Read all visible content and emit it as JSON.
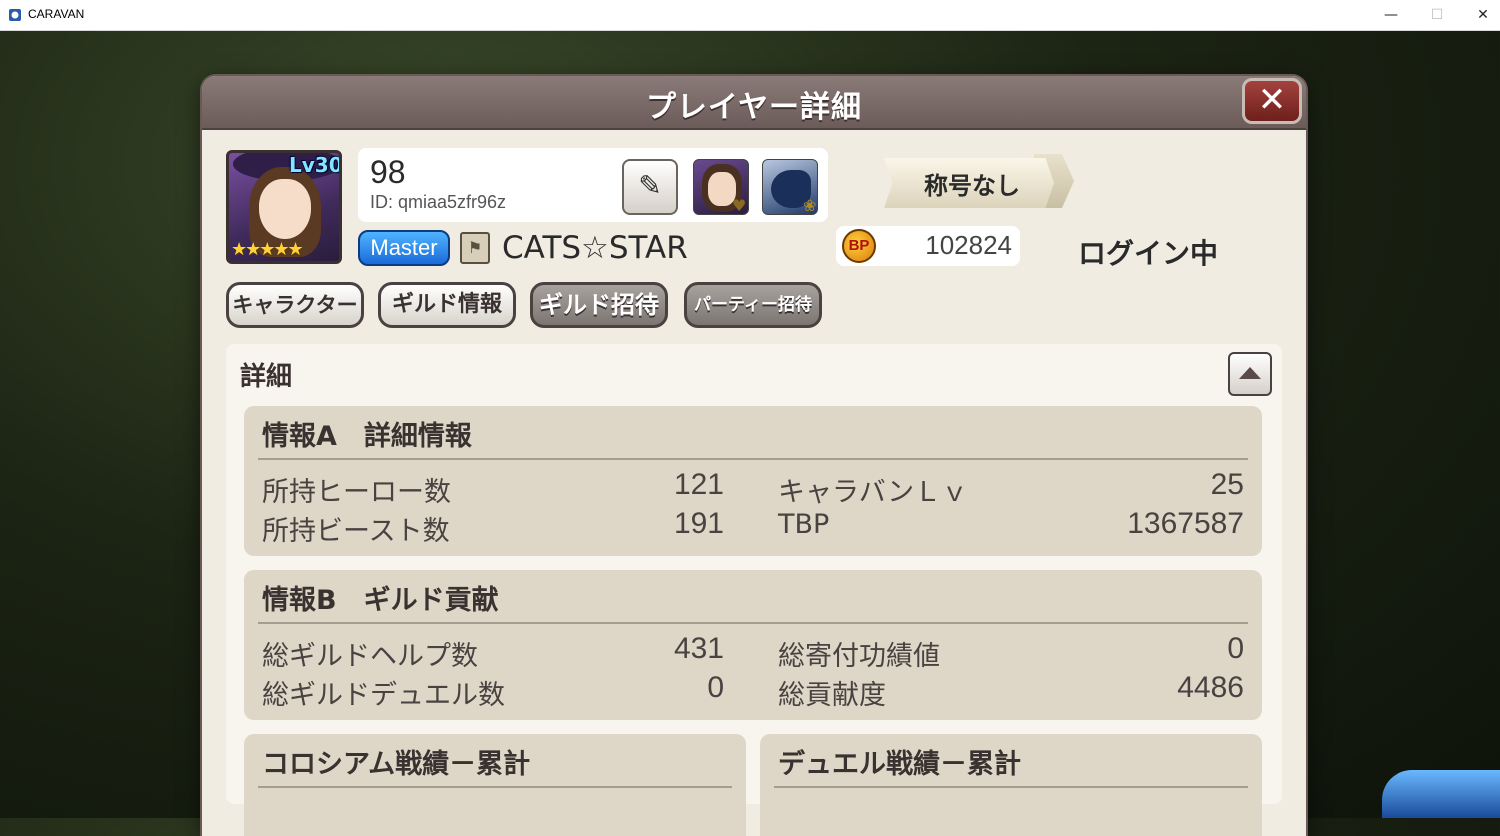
{
  "window": {
    "title": "CARAVAN",
    "min_glyph": "—",
    "max_glyph": "☐",
    "close_glyph": "✕"
  },
  "dialog": {
    "title": "プレイヤー詳細",
    "close_glyph": "✕"
  },
  "player": {
    "level": "Lv30",
    "stars": "★★★★★",
    "name": "98",
    "id": "ID: qmiaa5zfr96z",
    "rank_badge": "Master",
    "guild_name": "CATS☆STAR",
    "title": "称号なし",
    "bp_label": "BP",
    "bp_value": "102824",
    "status": "ログイン中"
  },
  "icons": {
    "edit": "✎",
    "guild_emblem": "⚑",
    "hero_mark": "♥",
    "beast_mark": "❀"
  },
  "tabs": [
    {
      "label": "キャラクター"
    },
    {
      "label": "ギルド情報"
    },
    {
      "label": "ギルド招待"
    },
    {
      "label": "パーティー招待"
    }
  ],
  "detail": {
    "label": "詳細",
    "info_a": {
      "title": "情報A　詳細情報",
      "rows": [
        {
          "left_label": "所持ヒーロー数",
          "left_value": "121",
          "right_label": "キャラバンＬｖ",
          "right_value": "25"
        },
        {
          "left_label": "所持ビースト数",
          "left_value": "191",
          "right_label": "TBP",
          "right_value": "1367587"
        }
      ]
    },
    "info_b": {
      "title": "情報B　ギルド貢献",
      "rows": [
        {
          "left_label": "総ギルドヘルプ数",
          "left_value": "431",
          "right_label": "総寄付功績値",
          "right_value": "0"
        },
        {
          "left_label": "総ギルドデュエル数",
          "left_value": "0",
          "right_label": "総貢献度",
          "right_value": "4486"
        }
      ]
    },
    "colosseum": {
      "title": "コロシアム戦績－累計"
    },
    "duel": {
      "title": "デュエル戦績－累計"
    }
  },
  "colors": {
    "header": "#6b5c5a",
    "close_button": "#8e2f2b",
    "master_badge": "#2a8ae8",
    "panel_bg": "#f0ece2",
    "card_bg": "#ded7c8"
  }
}
